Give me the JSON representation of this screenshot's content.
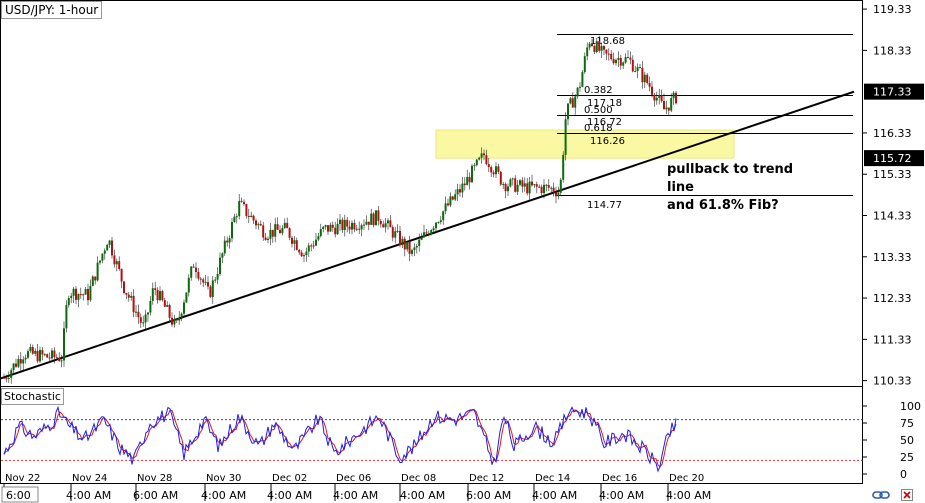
{
  "chart_title": "USD/JPY: 1-hour",
  "indicator_label": "Stochastic",
  "annotation_line1": "pullback to trend line",
  "annotation_line2": "and 61.8% Fib?",
  "colors": {
    "candle_up": "#0a6b0a",
    "candle_down": "#b01010",
    "fib_zone": "#fbf8a4",
    "stoch_k": "#1d1df0",
    "stoch_d": "#e01a1a",
    "price_tag": "#000000",
    "stoch_upper_line": "#3a3af0",
    "stoch_lower_line": "#e03030"
  },
  "icons": [
    "link-icon",
    "close-icon"
  ],
  "chart_data": {
    "type": "candlestick",
    "title": "USD/JPY: 1-hour",
    "price_axis": {
      "ticks": [
        "119.33",
        "118.33",
        "117.33",
        "116.33",
        "115.72",
        "115.33",
        "114.33",
        "113.33",
        "112.33",
        "111.33",
        "110.33"
      ],
      "ylim": [
        110.2,
        119.55
      ]
    },
    "current_price_tags": [
      "117.33",
      "115.72"
    ],
    "x_axis": {
      "date_labels": [
        "Nov 22",
        "Nov 24",
        "Nov 28",
        "Nov 30",
        "Dec 02",
        "Dec 06",
        "Dec 08",
        "Dec 12",
        "Dec 14",
        "Dec 16",
        "Dec 20"
      ],
      "time_labels": [
        "6:00",
        "4:00 AM",
        "6:00 AM",
        "4:00 AM",
        "4:00 AM",
        "4:00 AM",
        "4:00 AM",
        "6:00 AM",
        "4:00 AM",
        "4:00 AM",
        "4:00 AM"
      ],
      "time_label_prefix": "6:00"
    },
    "price_path": [
      [
        0,
        110.4
      ],
      [
        20,
        111.0
      ],
      [
        45,
        110.9
      ],
      [
        58,
        110.9
      ],
      [
        64,
        112.5
      ],
      [
        84,
        112.4
      ],
      [
        104,
        113.8
      ],
      [
        120,
        112.6
      ],
      [
        140,
        111.6
      ],
      [
        150,
        112.6
      ],
      [
        172,
        111.6
      ],
      [
        190,
        113.2
      ],
      [
        205,
        112.4
      ],
      [
        235,
        114.6
      ],
      [
        262,
        113.9
      ],
      [
        282,
        114.0
      ],
      [
        300,
        113.4
      ],
      [
        320,
        114.0
      ],
      [
        345,
        114.1
      ],
      [
        375,
        114.3
      ],
      [
        408,
        113.4
      ],
      [
        425,
        114.0
      ],
      [
        458,
        115.0
      ],
      [
        480,
        115.8
      ],
      [
        500,
        115.1
      ],
      [
        525,
        115.0
      ],
      [
        545,
        115.0
      ],
      [
        556,
        114.9
      ],
      [
        562,
        116.8
      ],
      [
        575,
        117.4
      ],
      [
        585,
        118.6
      ],
      [
        600,
        118.2
      ],
      [
        625,
        118.1
      ],
      [
        645,
        117.5
      ],
      [
        660,
        116.9
      ],
      [
        672,
        117.2
      ]
    ],
    "trend_line": [
      [
        0,
        110.33
      ],
      [
        850,
        117.33
      ]
    ],
    "fibonacci": {
      "swing_high": "118.68",
      "swing_low": "114.77",
      "levels": [
        {
          "ratio": "0.382",
          "price": "117.18"
        },
        {
          "ratio": "0.500",
          "price": "116.72"
        },
        {
          "ratio": "0.618",
          "price": "116.26"
        }
      ]
    },
    "highlight_zone": {
      "from_price": 115.72,
      "to_price": 116.4
    },
    "stochastic": {
      "ticks": [
        "100",
        "75",
        "50",
        "25",
        "0"
      ],
      "upper_level": 80,
      "lower_level": 20,
      "k_path": [
        [
          0,
          30
        ],
        [
          15,
          70
        ],
        [
          30,
          55
        ],
        [
          45,
          72
        ],
        [
          55,
          90
        ],
        [
          65,
          70
        ],
        [
          80,
          50
        ],
        [
          100,
          80
        ],
        [
          115,
          40
        ],
        [
          130,
          20
        ],
        [
          145,
          75
        ],
        [
          165,
          90
        ],
        [
          180,
          30
        ],
        [
          200,
          80
        ],
        [
          215,
          40
        ],
        [
          235,
          85
        ],
        [
          255,
          40
        ],
        [
          270,
          75
        ],
        [
          290,
          35
        ],
        [
          315,
          82
        ],
        [
          330,
          30
        ],
        [
          350,
          55
        ],
        [
          375,
          85
        ],
        [
          395,
          25
        ],
        [
          410,
          40
        ],
        [
          430,
          85
        ],
        [
          450,
          80
        ],
        [
          470,
          90
        ],
        [
          490,
          15
        ],
        [
          500,
          85
        ],
        [
          510,
          40
        ],
        [
          530,
          70
        ],
        [
          550,
          45
        ],
        [
          565,
          95
        ],
        [
          585,
          90
        ],
        [
          600,
          45
        ],
        [
          620,
          60
        ],
        [
          640,
          35
        ],
        [
          655,
          10
        ],
        [
          665,
          60
        ],
        [
          672,
          72
        ]
      ]
    }
  }
}
